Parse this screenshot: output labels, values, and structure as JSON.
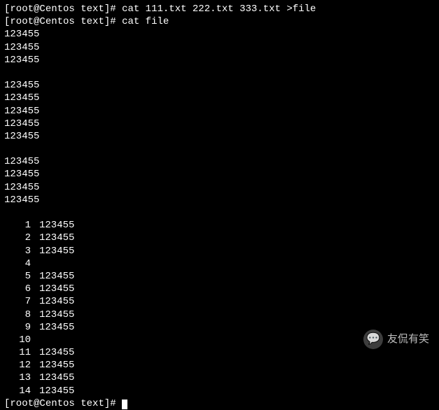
{
  "prompt": {
    "user": "root",
    "host": "Centos",
    "path": "text",
    "symbol": "#"
  },
  "commands": {
    "cmd1": "cat 111.txt 222.txt 333.txt >file",
    "cmd2": "cat file"
  },
  "output": {
    "block1": [
      "123455",
      "123455",
      "123455"
    ],
    "block2": [
      "123455",
      "123455",
      "123455",
      "123455",
      "123455"
    ],
    "block3": [
      "123455",
      "123455",
      "123455",
      "123455"
    ],
    "numbered": [
      {
        "n": "1",
        "v": "123455"
      },
      {
        "n": "2",
        "v": "123455"
      },
      {
        "n": "3",
        "v": "123455"
      },
      {
        "n": "4",
        "v": ""
      },
      {
        "n": "5",
        "v": "123455"
      },
      {
        "n": "6",
        "v": "123455"
      },
      {
        "n": "7",
        "v": "123455"
      },
      {
        "n": "8",
        "v": "123455"
      },
      {
        "n": "9",
        "v": "123455"
      },
      {
        "n": "10",
        "v": ""
      },
      {
        "n": "11",
        "v": "123455"
      },
      {
        "n": "12",
        "v": "123455"
      },
      {
        "n": "13",
        "v": "123455"
      },
      {
        "n": "14",
        "v": "123455"
      }
    ]
  },
  "watermark": {
    "text": "友侃有笑",
    "icon": "💬"
  }
}
